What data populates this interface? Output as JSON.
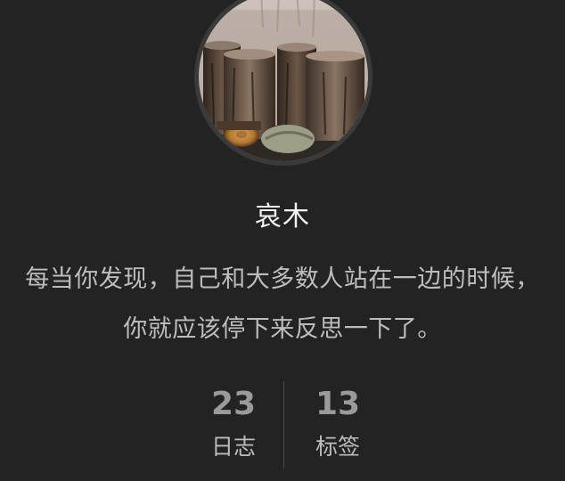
{
  "sidebar": {
    "author": {
      "name": "哀木",
      "motto": "每当你发现，自己和大多数人站在一边的时候，你就应该停下来反思一下了。"
    },
    "stats": {
      "posts": {
        "count": "23",
        "label": "日志"
      },
      "tags": {
        "count": "13",
        "label": "标签"
      }
    }
  },
  "colors": {
    "background": "#232323",
    "name": "#f2f2f2",
    "text": "#bdbdbd",
    "count": "#9a9a9a",
    "divider": "#4a4a4a"
  }
}
